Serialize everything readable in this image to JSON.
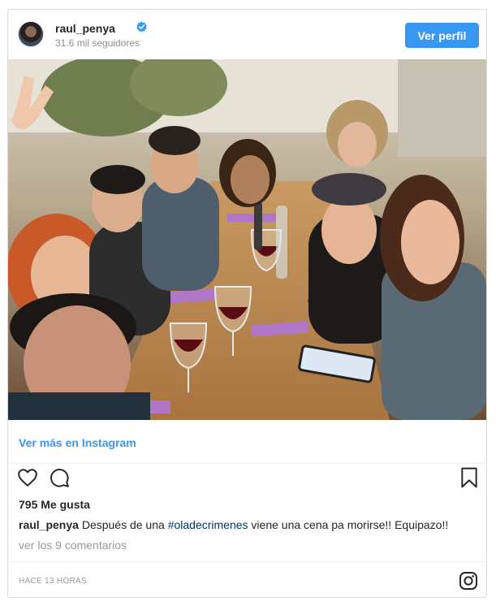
{
  "header": {
    "username": "raul_penya",
    "followers": "31.6 mil seguidores",
    "follow_button": "Ver perfil",
    "verified_icon": "verified-badge-icon",
    "verified_color": "#3897f0"
  },
  "link": {
    "view_more": "Ver más en Instagram"
  },
  "actions": {
    "like_icon": "heart-icon",
    "comment_icon": "comment-bubble-icon",
    "save_icon": "bookmark-icon"
  },
  "post": {
    "likes": "795 Me gusta",
    "caption_user": "raul_penya",
    "caption_before": " Después de una ",
    "hashtag": "#oladecrimenes",
    "caption_after": " viene una cena pa morirse!! Equipazo!!",
    "comments_link": "ver los 9 comentarios",
    "timestamp": "HACE 13 HORAS"
  },
  "footer": {
    "logo_icon": "instagram-logo-icon"
  },
  "colors": {
    "accent": "#3897f0",
    "hashtag": "#003569",
    "muted": "#999999",
    "text": "#262626"
  }
}
